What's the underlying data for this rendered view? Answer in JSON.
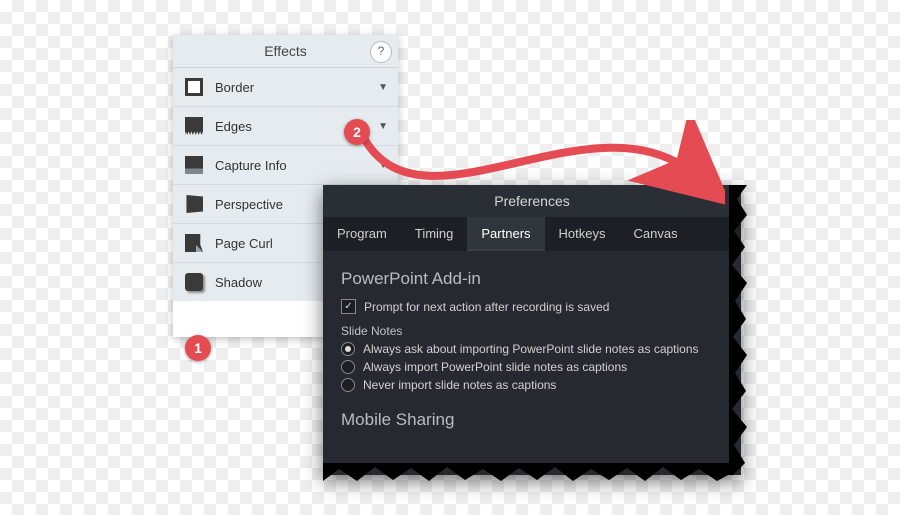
{
  "effects_panel": {
    "title": "Effects",
    "help_symbol": "?",
    "items": [
      {
        "label": "Border",
        "icon": "border-icon"
      },
      {
        "label": "Edges",
        "icon": "edges-icon"
      },
      {
        "label": "Capture Info",
        "icon": "capture-info-icon"
      },
      {
        "label": "Perspective",
        "icon": "perspective-icon"
      },
      {
        "label": "Page Curl",
        "icon": "page-curl-icon"
      },
      {
        "label": "Shadow",
        "icon": "shadow-icon"
      }
    ],
    "tab_label": "Effects"
  },
  "preferences": {
    "title": "Preferences",
    "tabs": [
      "Program",
      "Timing",
      "Partners",
      "Hotkeys",
      "Canvas"
    ],
    "active_tab_index": 2,
    "powerpoint_section": "PowerPoint Add-in",
    "prompt_checkbox": "Prompt for next action after recording is saved",
    "prompt_checked": true,
    "slide_notes_label": "Slide Notes",
    "radios": [
      "Always ask about importing PowerPoint slide notes as captions",
      "Always import PowerPoint slide notes as captions",
      "Never import slide notes as captions"
    ],
    "radio_selected_index": 0,
    "mobile_section": "Mobile Sharing"
  },
  "annotations": {
    "badge1": "1",
    "badge2": "2"
  }
}
